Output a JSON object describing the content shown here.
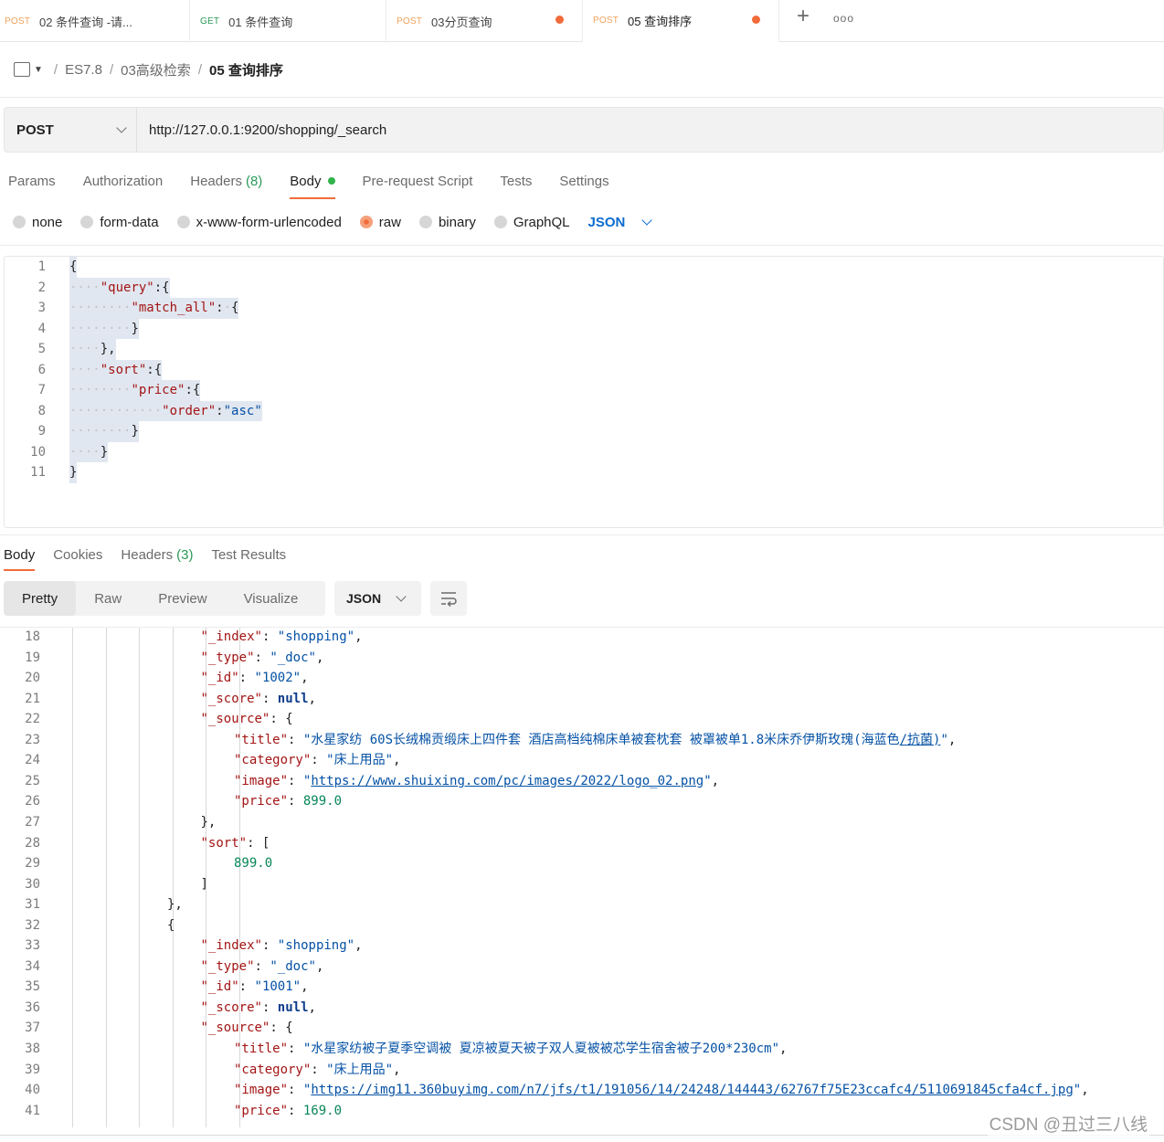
{
  "tabs": [
    {
      "method": "POST",
      "label": "02 条件查询 -请...",
      "dirty": false
    },
    {
      "method": "GET",
      "label": "01 条件查询",
      "dirty": false
    },
    {
      "method": "POST",
      "label": "03分页查询",
      "dirty": true
    },
    {
      "method": "POST",
      "label": "05 查询排序",
      "dirty": true,
      "active": true
    }
  ],
  "tab_more": "ooo",
  "breadcrumb": [
    "ES7.8",
    "03高级检索",
    "05 查询排序"
  ],
  "request": {
    "method": "POST",
    "url": "http://127.0.0.1:9200/shopping/_search"
  },
  "request_tabs": [
    {
      "label": "Params"
    },
    {
      "label": "Authorization"
    },
    {
      "label": "Headers",
      "count": "(8)"
    },
    {
      "label": "Body",
      "active": true,
      "indicator": true
    },
    {
      "label": "Pre-request Script"
    },
    {
      "label": "Tests"
    },
    {
      "label": "Settings"
    }
  ],
  "body_types": [
    "none",
    "form-data",
    "x-www-form-urlencoded",
    "raw",
    "binary",
    "GraphQL"
  ],
  "body_type_selected": "raw",
  "body_format": "JSON",
  "request_body": [
    "{",
    "····\"query\":{",
    "········\"match_all\":·{",
    "········}",
    "····},",
    "····\"sort\":{",
    "········\"price\":{",
    "············\"order\":\"asc\"",
    "········}",
    "····}",
    "}"
  ],
  "response_tabs": [
    {
      "label": "Body",
      "active": true
    },
    {
      "label": "Cookies"
    },
    {
      "label": "Headers",
      "count": "(3)"
    },
    {
      "label": "Test Results"
    }
  ],
  "view_modes": [
    "Pretty",
    "Raw",
    "Preview",
    "Visualize"
  ],
  "view_mode_selected": "Pretty",
  "response_format": "JSON",
  "response_lines": [
    {
      "n": "18",
      "indent": 5,
      "seg": [
        [
          "\"_index\"",
          "k"
        ],
        [
          ": ",
          "p"
        ],
        [
          "\"shopping\"",
          "s"
        ],
        [
          ",",
          "p"
        ]
      ]
    },
    {
      "n": "19",
      "indent": 5,
      "seg": [
        [
          "\"_type\"",
          "k"
        ],
        [
          ": ",
          "p"
        ],
        [
          "\"_doc\"",
          "s"
        ],
        [
          ",",
          "p"
        ]
      ]
    },
    {
      "n": "20",
      "indent": 5,
      "seg": [
        [
          "\"_id\"",
          "k"
        ],
        [
          ": ",
          "p"
        ],
        [
          "\"1002\"",
          "s"
        ],
        [
          ",",
          "p"
        ]
      ]
    },
    {
      "n": "21",
      "indent": 5,
      "seg": [
        [
          "\"_score\"",
          "k"
        ],
        [
          ": ",
          "p"
        ],
        [
          "null",
          "kw"
        ],
        [
          ",",
          "p"
        ]
      ]
    },
    {
      "n": "22",
      "indent": 5,
      "seg": [
        [
          "\"_source\"",
          "k"
        ],
        [
          ": {",
          "p"
        ]
      ]
    },
    {
      "n": "23",
      "indent": 6,
      "seg": [
        [
          "\"title\"",
          "k"
        ],
        [
          ": ",
          "p"
        ],
        [
          "\"水星家纺 60S长绒棉贡缎床上四件套 酒店高档纯棉床单被套枕套 被罩被单1.8米床乔伊斯玫瑰(海蓝色",
          "s"
        ],
        [
          "/抗菌)",
          "link"
        ],
        [
          "\"",
          "s"
        ],
        [
          ",",
          "p"
        ]
      ]
    },
    {
      "n": "24",
      "indent": 6,
      "seg": [
        [
          "\"category\"",
          "k"
        ],
        [
          ": ",
          "p"
        ],
        [
          "\"床上用品\"",
          "s"
        ],
        [
          ",",
          "p"
        ]
      ]
    },
    {
      "n": "25",
      "indent": 6,
      "seg": [
        [
          "\"image\"",
          "k"
        ],
        [
          ": ",
          "p"
        ],
        [
          "\"",
          "s"
        ],
        [
          "https://www.shuixing.com/pc/images/2022/logo_02.png",
          "link"
        ],
        [
          "\"",
          "s"
        ],
        [
          ",",
          "p"
        ]
      ]
    },
    {
      "n": "26",
      "indent": 6,
      "seg": [
        [
          "\"price\"",
          "k"
        ],
        [
          ": ",
          "p"
        ],
        [
          "899.0",
          "num"
        ]
      ]
    },
    {
      "n": "27",
      "indent": 5,
      "seg": [
        [
          "},",
          "p"
        ]
      ]
    },
    {
      "n": "28",
      "indent": 5,
      "seg": [
        [
          "\"sort\"",
          "k"
        ],
        [
          ": [",
          "p"
        ]
      ]
    },
    {
      "n": "29",
      "indent": 6,
      "seg": [
        [
          "899.0",
          "num"
        ]
      ]
    },
    {
      "n": "30",
      "indent": 5,
      "seg": [
        [
          "]",
          "p"
        ]
      ]
    },
    {
      "n": "31",
      "indent": 4,
      "seg": [
        [
          "},",
          "p"
        ]
      ]
    },
    {
      "n": "32",
      "indent": 4,
      "seg": [
        [
          "{",
          "p"
        ]
      ]
    },
    {
      "n": "33",
      "indent": 5,
      "seg": [
        [
          "\"_index\"",
          "k"
        ],
        [
          ": ",
          "p"
        ],
        [
          "\"shopping\"",
          "s"
        ],
        [
          ",",
          "p"
        ]
      ]
    },
    {
      "n": "34",
      "indent": 5,
      "seg": [
        [
          "\"_type\"",
          "k"
        ],
        [
          ": ",
          "p"
        ],
        [
          "\"_doc\"",
          "s"
        ],
        [
          ",",
          "p"
        ]
      ]
    },
    {
      "n": "35",
      "indent": 5,
      "seg": [
        [
          "\"_id\"",
          "k"
        ],
        [
          ": ",
          "p"
        ],
        [
          "\"1001\"",
          "s"
        ],
        [
          ",",
          "p"
        ]
      ]
    },
    {
      "n": "36",
      "indent": 5,
      "seg": [
        [
          "\"_score\"",
          "k"
        ],
        [
          ": ",
          "p"
        ],
        [
          "null",
          "kw"
        ],
        [
          ",",
          "p"
        ]
      ]
    },
    {
      "n": "37",
      "indent": 5,
      "seg": [
        [
          "\"_source\"",
          "k"
        ],
        [
          ": {",
          "p"
        ]
      ]
    },
    {
      "n": "38",
      "indent": 6,
      "seg": [
        [
          "\"title\"",
          "k"
        ],
        [
          ": ",
          "p"
        ],
        [
          "\"水星家纺被子夏季空调被 夏凉被夏天被子双人夏被被芯学生宿舍被子200*230cm\"",
          "s"
        ],
        [
          ",",
          "p"
        ]
      ]
    },
    {
      "n": "39",
      "indent": 6,
      "seg": [
        [
          "\"category\"",
          "k"
        ],
        [
          ": ",
          "p"
        ],
        [
          "\"床上用品\"",
          "s"
        ],
        [
          ",",
          "p"
        ]
      ]
    },
    {
      "n": "40",
      "indent": 6,
      "seg": [
        [
          "\"image\"",
          "k"
        ],
        [
          ": ",
          "p"
        ],
        [
          "\"",
          "s"
        ],
        [
          "https://img11.360buyimg.com/n7/jfs/t1/191056/14/24248/144443/62767f75E23ccafc4/5110691845cfa4cf.jpg",
          "link"
        ],
        [
          "\"",
          "s"
        ],
        [
          ",",
          "p"
        ]
      ]
    },
    {
      "n": "41",
      "indent": 6,
      "seg": [
        [
          "\"price\"",
          "k"
        ],
        [
          ": ",
          "p"
        ],
        [
          "169.0",
          "num"
        ]
      ]
    }
  ],
  "watermark": "CSDN @丑过三八线",
  "colors": {
    "accent": "#f26b3a",
    "post": "#f1a25b",
    "get": "#2a9a57",
    "json": "#0b6ccf"
  }
}
